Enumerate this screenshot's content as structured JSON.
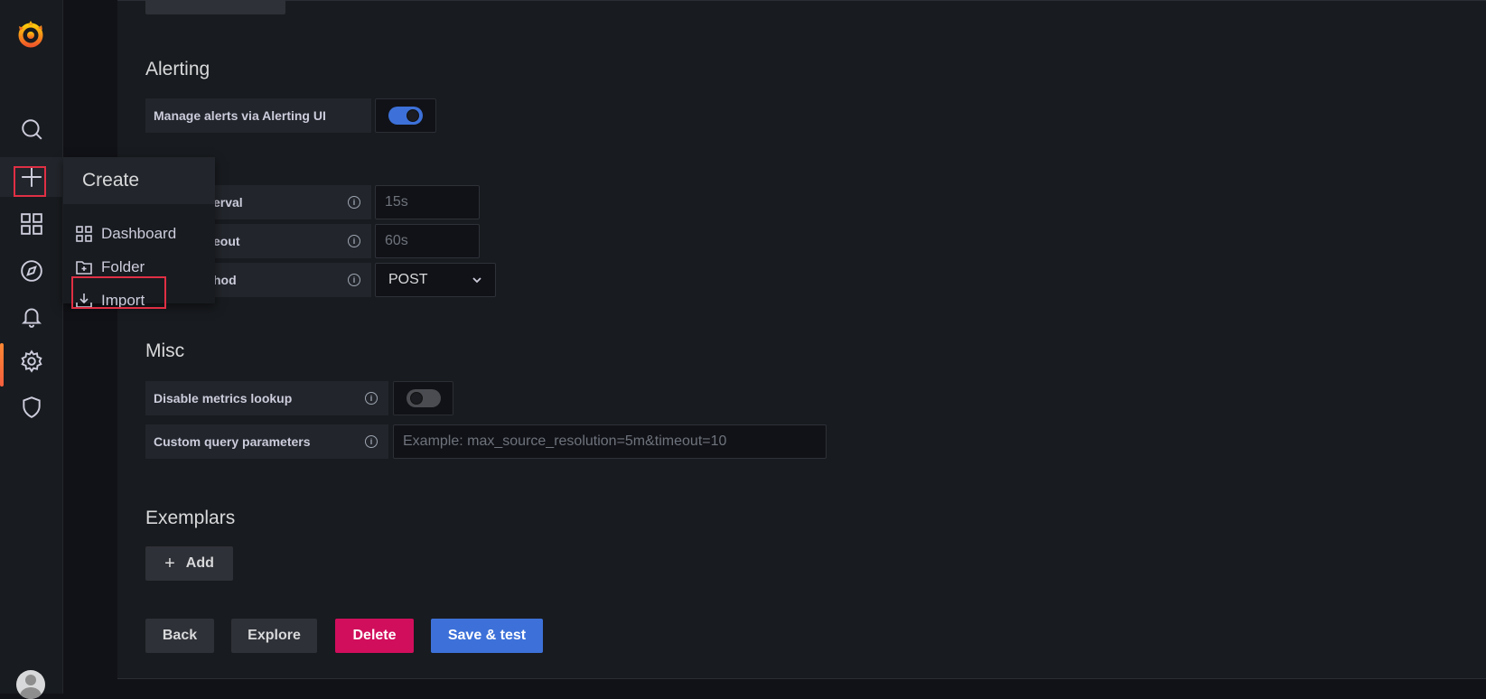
{
  "sidebar": {
    "logo_icon": "grafana-logo-icon",
    "items": [
      {
        "name": "search",
        "icon": "search-icon"
      },
      {
        "name": "create",
        "icon": "plus-icon"
      },
      {
        "name": "dashboards",
        "icon": "grid-icon"
      },
      {
        "name": "explore",
        "icon": "compass-icon"
      },
      {
        "name": "alerting",
        "icon": "bell-icon"
      },
      {
        "name": "configuration",
        "icon": "gear-icon"
      },
      {
        "name": "server-admin",
        "icon": "shield-icon"
      }
    ]
  },
  "create_menu": {
    "title": "Create",
    "items": [
      {
        "label": "Dashboard",
        "icon": "apps-icon"
      },
      {
        "label": "Folder",
        "icon": "folder-plus-icon"
      },
      {
        "label": "Import",
        "icon": "import-icon"
      }
    ]
  },
  "alerting": {
    "title": "Alerting",
    "manage_label": "Manage alerts via Alerting UI",
    "manage_enabled": true
  },
  "http": {
    "scrape_label": "erval",
    "scrape_placeholder": "15s",
    "timeout_label": "eout",
    "timeout_placeholder": "60s",
    "method_label": "hod",
    "method_value": "POST"
  },
  "misc": {
    "title": "Misc",
    "disable_metrics_label": "Disable metrics lookup",
    "disable_metrics_enabled": false,
    "custom_query_label": "Custom query parameters",
    "custom_query_placeholder": "Example: max_source_resolution=5m&timeout=10"
  },
  "exemplars": {
    "title": "Exemplars",
    "add_label": "Add"
  },
  "actions": {
    "back": "Back",
    "explore": "Explore",
    "delete": "Delete",
    "save_test": "Save & test"
  },
  "colors": {
    "primary": "#3d71d9",
    "danger": "#d10e5c",
    "highlight_box": "#e02f44"
  }
}
